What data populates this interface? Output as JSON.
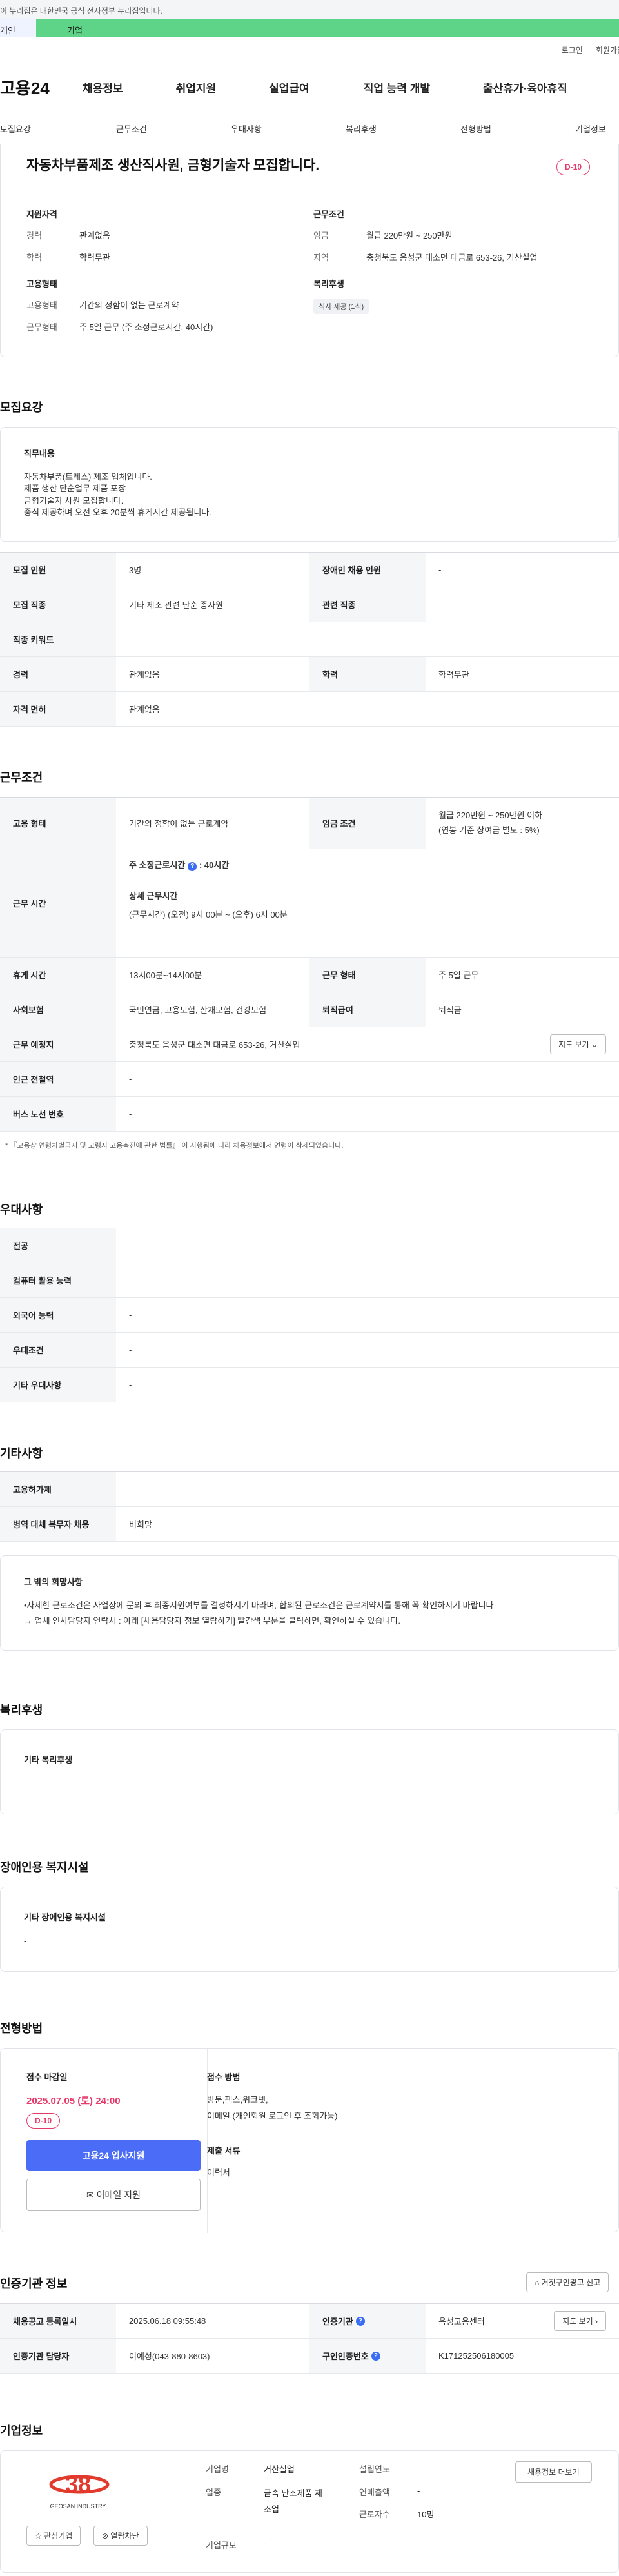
{
  "gov_banner": "이 누리집은 대한민국 공식 전자정부 누리집입니다.",
  "top_tabs": {
    "a": "개인",
    "b": "기업"
  },
  "util": {
    "login": "로그인",
    "join": "회원가입"
  },
  "logo": "고용24",
  "main_nav": [
    "채용정보",
    "취업지원",
    "실업급여",
    "직업 능력 개발",
    "출산휴가·육아휴직"
  ],
  "sub_nav": [
    "모집요강",
    "근무조건",
    "우대사항",
    "복리후생",
    "전형방법",
    "기업정보"
  ],
  "summary": {
    "title": "자동차부품제조 생산직사원, 금형기술자 모집합니다.",
    "dday": "D-10",
    "qual_h": "지원자격",
    "career_k": "경력",
    "career_v": "관계없음",
    "edu_k": "학력",
    "edu_v": "학력무관",
    "emp_h": "고용형태",
    "emp_k": "고용형태",
    "emp_v": "기간의 정함이 없는 근로계약",
    "work_k": "근무형태",
    "work_v": "주 5일 근무 (주 소정근로시간: 40시간)",
    "cond_h": "근무조건",
    "wage_k": "임금",
    "wage_v": "월급 220만원 ~ 250만원",
    "region_k": "지역",
    "region_v": "충청북도 음성군 대소면 대금로 653-26, 거산실업",
    "welfare_h": "복리후생",
    "welfare_chip": "식사 제공 (1식)"
  },
  "recruit": {
    "title": "모집요강",
    "duty_h": "직무내용",
    "duty_lines": [
      "자동차부품(트레스) 제조 업체입니다.",
      "제품 생산 단순업무 제품 포장",
      "금형기술자 사원 모집합니다.",
      "중식 제공하며 오전 오후 20분씩 휴게시간 제공됩니다."
    ],
    "rows": [
      {
        "k1": "모집 인원",
        "v1": "3명",
        "k2": "장애인 채용 인원",
        "v2": "-"
      },
      {
        "k1": "모집 직종",
        "v1": "기타 제조 관련 단순 종사원",
        "k2": "관련 직종",
        "v2": "-"
      },
      {
        "k1": "직종 키워드",
        "v1": "-"
      },
      {
        "k1": "경력",
        "v1": "관계없음",
        "k2": "학력",
        "v2": "학력무관"
      },
      {
        "k1": "자격 면허",
        "v1": "관계없음"
      }
    ]
  },
  "conditions": {
    "title": "근무조건",
    "emp_k": "고용 형태",
    "emp_v": "기간의 정함이 없는 근로계약",
    "wage_k": "임금 조건",
    "wage_v1": "월급 220만원 ~ 250만원 이하",
    "wage_v2": "(연봉 기준 상여금 별도 : 5%)",
    "time_k": "근무 시간",
    "time_l1": "주 소정근로시간",
    "time_l1_val": ": 40시간",
    "time_l2": "상세 근무시간",
    "time_l3": "(근무시간) (오전) 9시 00분 ~ (오후) 6시 00분",
    "rest_k": "휴게 시간",
    "rest_v": "13시00분~14시00분",
    "shift_k": "근무 형태",
    "shift_v": "주 5일 근무",
    "ins_k": "사회보험",
    "ins_v": "국민연금, 고용보험, 산재보험, 건강보험",
    "sev_k": "퇴직급여",
    "sev_v": "퇴직금",
    "place_k": "근무 예정지",
    "place_v": "충청북도 음성군 대소면 대금로 653-26, 거산실업",
    "map_btn": "지도 보기",
    "subway_k": "인근 전철역",
    "subway_v": "-",
    "bus_k": "버스 노선 번호",
    "bus_v": "-",
    "note": "* 『고용상 연령차별금지 및 고령자 고용촉진에 관한 법률』 이 시행됨에 따라 채용정보에서 연령이 삭제되었습니다."
  },
  "prefer": {
    "title": "우대사항",
    "rows": [
      {
        "k": "전공",
        "v": "-"
      },
      {
        "k": "컴퓨터 활용 능력",
        "v": "-"
      },
      {
        "k": "외국어 능력",
        "v": "-"
      },
      {
        "k": "우대조건",
        "v": "-"
      },
      {
        "k": "기타 우대사항",
        "v": "-"
      }
    ]
  },
  "etc": {
    "title": "기타사항",
    "rows": [
      {
        "k": "고용허가제",
        "v": "-"
      },
      {
        "k": "병역 대체 복무자 채용",
        "v": "비희망"
      }
    ],
    "box_h": "그 밖의 희망사항",
    "box_l1": "•자세한 근로조건은 사업장에 문의 후 최종지원여부를 결정하시기 바라며, 합의된 근로조건은 근로계약서를 통해 꼭 확인하시기 바랍니다",
    "box_l2": "→ 업체 인사담당자 연락처 : 아래 [채용담당자 정보 열람하기] 빨간색 부분을 클릭하면, 확인하실 수 있습니다."
  },
  "welfare": {
    "title": "복리후생",
    "h": "기타 복리후생",
    "v": "-"
  },
  "disabled": {
    "title": "장애인용 복지시설",
    "h": "기타 장애인용 복지시설",
    "v": "-"
  },
  "selection": {
    "title": "전형방법",
    "deadline_h": "접수 마감일",
    "deadline": "2025.07.05 (토) 24:00",
    "dday": "D-10",
    "apply_btn": "고용24 입사지원",
    "email_btn": "이메일 지원",
    "method_h": "접수 방법",
    "method_l1": "방문,팩스,워크넷,",
    "method_l2": "이메일 (개인회원 로그인 후 조회가능)",
    "docs_h": "제출 서류",
    "docs_v": "이력서"
  },
  "cert": {
    "title": "인증기관 정보",
    "report_btn": "거짓구인광고 신고",
    "reg_k": "채용공고 등록일시",
    "reg_v": "2025.06.18 09:55:48",
    "org_k": "인증기관",
    "org_v": "음성고용센터",
    "map_btn": "지도 보기",
    "mgr_k": "인증기관 담당자",
    "mgr_v": "이예성(043-880-8603)",
    "num_k": "구인인증번호",
    "num_v": "K171252506180005"
  },
  "company": {
    "title": "기업정보",
    "logo_text": "GEOSAN INDUSTRY",
    "fav_btn": "관심기업",
    "block_btn": "열람차단",
    "name_k": "기업명",
    "name_v": "거산실업",
    "ind_k": "업종",
    "ind_v1": "금속 단조제품 제",
    "ind_v2": "조업",
    "size_k": "기업규모",
    "size_v": "-",
    "year_k": "설립연도",
    "year_v": "-",
    "sales_k": "연매출액",
    "sales_v": "-",
    "emp_k": "근로자수",
    "emp_v": "10명",
    "more_btn": "채용정보 더보기"
  }
}
